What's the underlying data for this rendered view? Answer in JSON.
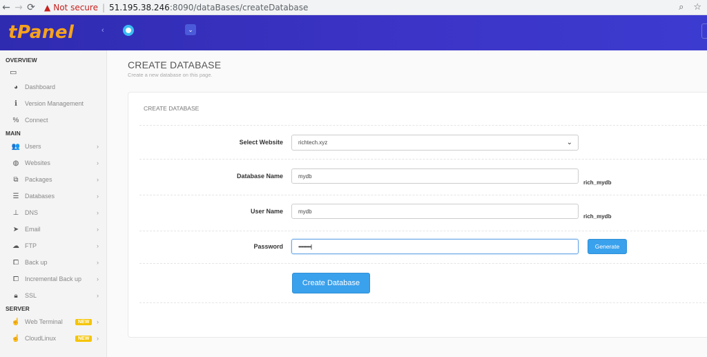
{
  "browser": {
    "not_secure": "Not secure",
    "host": "51.195.38.246",
    "path": ":8090/dataBases/createDatabase"
  },
  "header": {
    "logo": "tPanel"
  },
  "sidebar": {
    "sections": {
      "overview": "OVERVIEW",
      "main": "MAIN",
      "server": "SERVER"
    },
    "overview_items": [
      "Dashboard",
      "Version Management",
      "Connect"
    ],
    "main_items": [
      "Users",
      "Websites",
      "Packages",
      "Databases",
      "DNS",
      "Email",
      "FTP",
      "Back up",
      "Incremental Back up",
      "SSL"
    ],
    "server_items": [
      "Web Terminal",
      "CloudLinux"
    ],
    "badge_new": "NEW"
  },
  "page": {
    "title": "CREATE DATABASE",
    "subtitle": "Create a new database on this page."
  },
  "form": {
    "card_title": "CREATE DATABASE",
    "website_label": "Select Website",
    "website_value": "richtech.xyz",
    "dbname_label": "Database Name",
    "dbname_value": "mydb",
    "dbname_suffix": "rich_mydb",
    "username_label": "User Name",
    "username_value": "mydb",
    "username_suffix": "rich_mydb",
    "password_label": "Password",
    "password_value": "••••••••••",
    "generate_label": "Generate",
    "submit_label": "Create Database"
  },
  "colors": {
    "header_bg": "#3c34c7",
    "logo": "#f6a21d",
    "primary_button": "#3aa1ec",
    "badge": "#f5c400"
  }
}
